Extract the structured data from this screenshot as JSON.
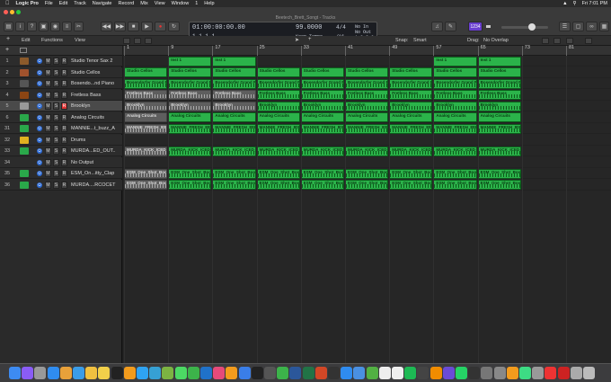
{
  "menubar": {
    "app": "Logic Pro",
    "items": [
      "File",
      "Edit",
      "Track",
      "Navigate",
      "Record",
      "Mix",
      "View",
      "Window",
      "1",
      "Help"
    ],
    "clock": "Fri 7:01 PM"
  },
  "window_title": "Beetech_Brett_Songt - Tracks",
  "lcd": {
    "time": "01:00:00:00.00",
    "bars": "1  1  1     1",
    "tempo": "99.0000",
    "tempo_label": "Keep Tempo",
    "sig_top": "4/4",
    "sig_bottom": "/16",
    "in_label": "No In",
    "out_label": "No Out",
    "key": "1 C-2  0"
  },
  "cpu_badge": "1234",
  "subbar": {
    "edit": "Edit",
    "functions": "Functions",
    "view": "View",
    "snap_label": "Snap:",
    "snap_value": "Smart",
    "drag_label": "Drag:",
    "drag_value": "No Overlap"
  },
  "ruler": [
    "1",
    "9",
    "17",
    "25",
    "33",
    "41",
    "49",
    "57",
    "65",
    "73",
    "81"
  ],
  "tracks": [
    {
      "num": "1",
      "name": "Studio Tenor Sax 2",
      "icon": "sax-icon",
      "icolor": "#8b5a2b",
      "rec": false,
      "sel": false
    },
    {
      "num": "2",
      "name": "Studio Cellos",
      "icon": "cello-icon",
      "icolor": "#a0522d",
      "rec": false,
      "sel": false
    },
    {
      "num": "3",
      "name": "Bosendo...nd Piano",
      "icon": "piano-icon",
      "icolor": "#555",
      "rec": false,
      "sel": false
    },
    {
      "num": "4",
      "name": "Fretless Bass",
      "icon": "bass-icon",
      "icolor": "#8b4513",
      "rec": false,
      "sel": false
    },
    {
      "num": "5",
      "name": "Brooklyn",
      "icon": "drum-kit-icon",
      "icolor": "#999",
      "rec": true,
      "sel": true
    },
    {
      "num": "6",
      "name": "Analog Circuits",
      "icon": "synth-icon",
      "icolor": "#2aa84a",
      "rec": false,
      "sel": false
    },
    {
      "num": "31",
      "name": "MANNIE...t_buzz_A",
      "icon": "waveform-icon",
      "icolor": "#2aa84a",
      "rec": false,
      "sel": false
    },
    {
      "num": "32",
      "name": "Drums",
      "icon": "drummer-icon",
      "icolor": "#e0b020",
      "rec": false,
      "sel": false
    },
    {
      "num": "33",
      "name": "MURDA...ED_OUT..",
      "icon": "waveform-icon",
      "icolor": "#2aa84a",
      "rec": false,
      "sel": false
    },
    {
      "num": "34",
      "name": "No Output",
      "icon": "none",
      "icolor": "transparent",
      "rec": false,
      "sel": false
    },
    {
      "num": "35",
      "name": "ESM_On...itty_Clap",
      "icon": "waveform-icon",
      "icolor": "#2aa84a",
      "rec": false,
      "sel": false
    },
    {
      "num": "36",
      "name": "MURDA....RCOCET",
      "icon": "waveform-icon",
      "icolor": "#2aa84a",
      "rec": false,
      "sel": false
    }
  ],
  "regions": {
    "inst1": "Inst 1",
    "cellos": "Studio Cellos",
    "piano": "Bosendorfer Grand Pi",
    "bass": "Fretless Bass",
    "brooklyn": "Brooklyn",
    "analog": "Analog Circuits",
    "mannie": "MANNIE_FRESH_808_",
    "murda": "MURDA_KICK_ICED_OU",
    "esm": "ESM_One_Shot_Boom_"
  }
}
